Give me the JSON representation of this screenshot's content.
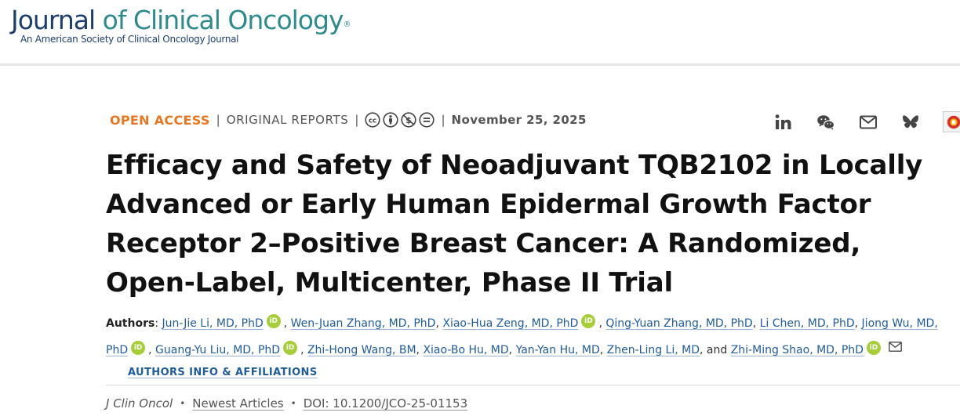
{
  "header": {
    "logo_journal": "Journal",
    "logo_rest": " of Clinical Oncology",
    "logo_reg": "®",
    "logo_subtitle": "An American Society of Clinical Oncology Journal"
  },
  "meta": {
    "open_access": "OPEN ACCESS",
    "separator": "|",
    "article_type": "ORIGINAL REPORTS",
    "date": "November 25, 2025",
    "license_icons": [
      "cc-icon",
      "by-icon",
      "nc-icon",
      "nd-icon"
    ]
  },
  "share": {
    "icons": [
      "linkedin-icon",
      "wechat-icon",
      "email-icon",
      "bluesky-icon",
      "app-icon"
    ]
  },
  "article": {
    "title": "Efficacy and Safety of Neoadjuvant TQB2102 in Locally Advanced or Early Human Epidermal Growth Factor Receptor 2–Positive Breast Cancer: A Randomized, Open-Label, Multicenter, Phase II Trial"
  },
  "authors": {
    "label": "Authors",
    "label_suffix": ": ",
    "list": [
      {
        "name": "Jun-Jie Li, MD, PhD",
        "orcid": true
      },
      {
        "name": "Wen-Juan Zhang, MD, PhD",
        "orcid": false
      },
      {
        "name": "Xiao-Hua Zeng, MD, PhD",
        "orcid": true
      },
      {
        "name": "Qing-Yuan Zhang, MD, PhD",
        "orcid": false
      },
      {
        "name": "Li Chen, MD, PhD",
        "orcid": false
      },
      {
        "name": "Jiong Wu, MD, PhD",
        "orcid": true
      },
      {
        "name": "Guang-Yu Liu, MD, PhD",
        "orcid": true
      },
      {
        "name": "Zhi-Hong Wang, BM",
        "orcid": false
      },
      {
        "name": "Xiao-Bo Hu, MD",
        "orcid": false
      },
      {
        "name": "Yan-Yan Hu, MD",
        "orcid": false
      },
      {
        "name": "Zhen-Ling Li, MD",
        "orcid": false
      },
      {
        "name": "Zhi-Ming Shao, MD, PhD",
        "orcid": true
      }
    ],
    "and_text": "and",
    "orcid_text": "iD",
    "affiliations_link": "AUTHORS INFO & AFFILIATIONS"
  },
  "citation": {
    "journal": "J Clin Oncol",
    "bullet": "•",
    "newest_articles": "Newest Articles",
    "doi": "DOI: 10.1200/JCO-25-01153"
  },
  "colors": {
    "open_access": "#e87722",
    "link": "#1f5c9e",
    "logo_navy": "#1d3f6e",
    "logo_teal": "#2e8b8b",
    "orcid": "#a6ce39"
  }
}
